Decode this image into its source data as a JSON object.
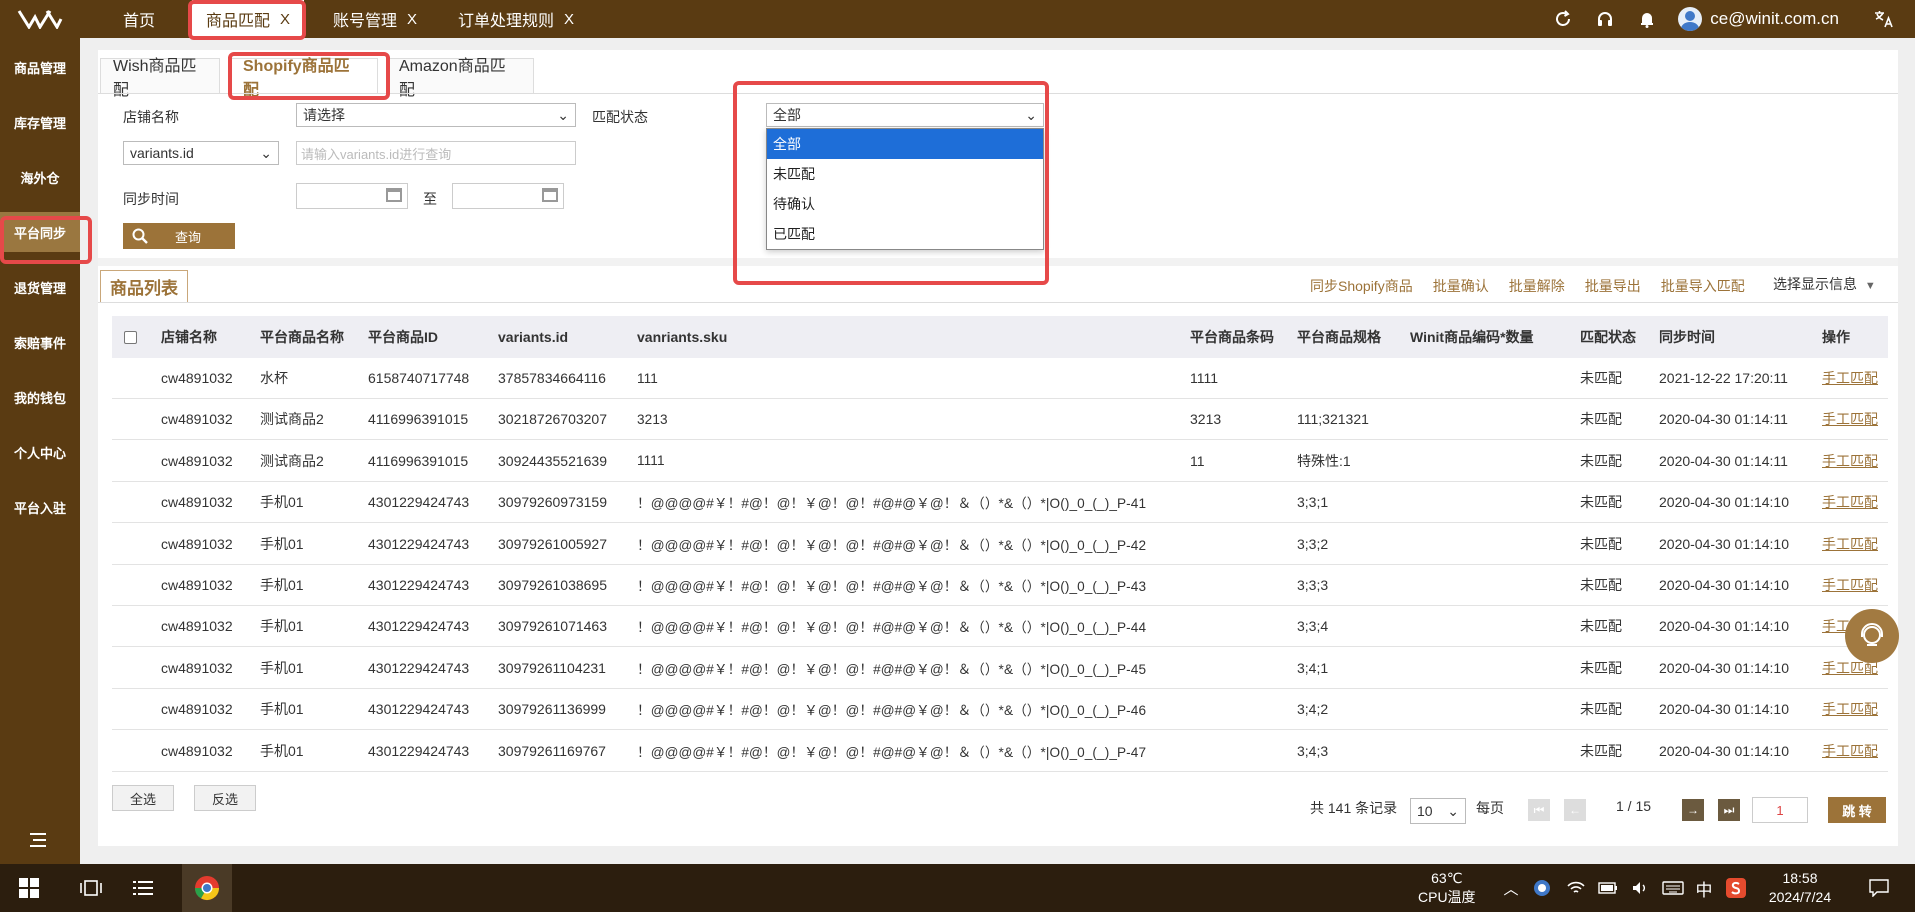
{
  "topbar": {
    "tabs": [
      {
        "label": "首页",
        "closable": false
      },
      {
        "label": "商品匹配",
        "closable": true
      },
      {
        "label": "账号管理",
        "closable": true
      },
      {
        "label": "订单处理规则",
        "closable": true
      }
    ],
    "close_glyph": "X",
    "user_email": "ce@winit.com.cn",
    "icons": [
      "refresh-icon",
      "headset-icon",
      "bell-icon",
      "translate-icon"
    ]
  },
  "sidebar": {
    "items": [
      "商品管理",
      "库存管理",
      "海外仓",
      "平台同步",
      "退货管理",
      "索赔事件",
      "我的钱包",
      "个人中心",
      "平台入驻"
    ],
    "active": "平台同步"
  },
  "subtabs": [
    "Wish商品匹配",
    "Shopify商品匹配",
    "Amazon商品匹配"
  ],
  "filters": {
    "store_label": "店铺名称",
    "store_value": "请选择",
    "match_status_label": "匹配状态",
    "match_status_value": "全部",
    "id_type_value": "variants.id",
    "id_placeholder": "请输入variants.id进行查询",
    "sync_time_label": "同步时间",
    "to_label": "至",
    "query_button": "查询"
  },
  "dropdown": {
    "options": [
      "全部",
      "未匹配",
      "待确认",
      "已匹配"
    ],
    "selected": "全部"
  },
  "list": {
    "tab": "商品列表",
    "actions": [
      "同步Shopify商品",
      "批量确认",
      "批量解除",
      "批量导出",
      "批量导入匹配"
    ],
    "display_info": "选择显示信息",
    "columns": [
      "店铺名称",
      "平台商品名称",
      "平台商品ID",
      "variants.id",
      "vanriants.sku",
      "平台商品条码",
      "平台商品规格",
      "Winit商品编码*数量",
      "匹配状态",
      "同步时间",
      "操作"
    ],
    "rows": [
      [
        "cw4891032",
        "水杯",
        "6158740717748",
        "37857834664116",
        "111",
        "1111",
        "",
        "",
        "未匹配",
        "2021-12-22 17:20:11",
        "手工匹配"
      ],
      [
        "cw4891032",
        "测试商品2",
        "4116996391015",
        "30218726703207",
        "3213",
        "3213",
        "111;321321",
        "",
        "未匹配",
        "2020-04-30 01:14:11",
        "手工匹配"
      ],
      [
        "cw4891032",
        "测试商品2",
        "4116996391015",
        "30924435521639",
        "1111",
        "11",
        "特殊性:1",
        "",
        "未匹配",
        "2020-04-30 01:14:11",
        "手工匹配"
      ],
      [
        "cw4891032",
        "手机01",
        "4301229424743",
        "30979260973159",
        "！@@@@#￥！#@！@！￥@！@！#@#@￥@！＆（）*&（）*|O()_0_(_)_P-41",
        "",
        "3;3;1",
        "",
        "未匹配",
        "2020-04-30 01:14:10",
        "手工匹配"
      ],
      [
        "cw4891032",
        "手机01",
        "4301229424743",
        "30979261005927",
        "！@@@@#￥！#@！@！￥@！@！#@#@￥@！＆（）*&（）*|O()_0_(_)_P-42",
        "",
        "3;3;2",
        "",
        "未匹配",
        "2020-04-30 01:14:10",
        "手工匹配"
      ],
      [
        "cw4891032",
        "手机01",
        "4301229424743",
        "30979261038695",
        "！@@@@#￥！#@！@！￥@！@！#@#@￥@！＆（）*&（）*|O()_0_(_)_P-43",
        "",
        "3;3;3",
        "",
        "未匹配",
        "2020-04-30 01:14:10",
        "手工匹配"
      ],
      [
        "cw4891032",
        "手机01",
        "4301229424743",
        "30979261071463",
        "！@@@@#￥！#@！@！￥@！@！#@#@￥@！＆（）*&（）*|O()_0_(_)_P-44",
        "",
        "3;3;4",
        "",
        "未匹配",
        "2020-04-30 01:14:10",
        "手工匹配"
      ],
      [
        "cw4891032",
        "手机01",
        "4301229424743",
        "30979261104231",
        "！@@@@#￥！#@！@！￥@！@！#@#@￥@！＆（）*&（）*|O()_0_(_)_P-45",
        "",
        "3;4;1",
        "",
        "未匹配",
        "2020-04-30 01:14:10",
        "手工匹配"
      ],
      [
        "cw4891032",
        "手机01",
        "4301229424743",
        "30979261136999",
        "！@@@@#￥！#@！@！￥@！@！#@#@￥@！＆（）*&（）*|O()_0_(_)_P-46",
        "",
        "3;4;2",
        "",
        "未匹配",
        "2020-04-30 01:14:10",
        "手工匹配"
      ],
      [
        "cw4891032",
        "手机01",
        "4301229424743",
        "30979261169767",
        "！@@@@#￥！#@！@！￥@！@！#@#@￥@！＆（）*&（）*|O()_0_(_)_P-47",
        "",
        "3;4;3",
        "",
        "未匹配",
        "2020-04-30 01:14:10",
        "手工匹配"
      ]
    ],
    "select_all": "全选",
    "invert_select": "反选"
  },
  "pager": {
    "total": "共 141 条记录",
    "page_size": "10",
    "per_page": "每页",
    "page_info": "1 / 15",
    "page_input": "1",
    "go_button": "跳 转"
  },
  "taskbar": {
    "temp": "63℃",
    "temp_label": "CPU温度",
    "ime": "中",
    "time": "18:58",
    "date": "2024/7/24"
  },
  "colors": {
    "brand_dark": "#5a3b12",
    "brand_accent": "#9c7339",
    "highlight_red": "#e64949",
    "select_blue": "#1e6ed8"
  }
}
